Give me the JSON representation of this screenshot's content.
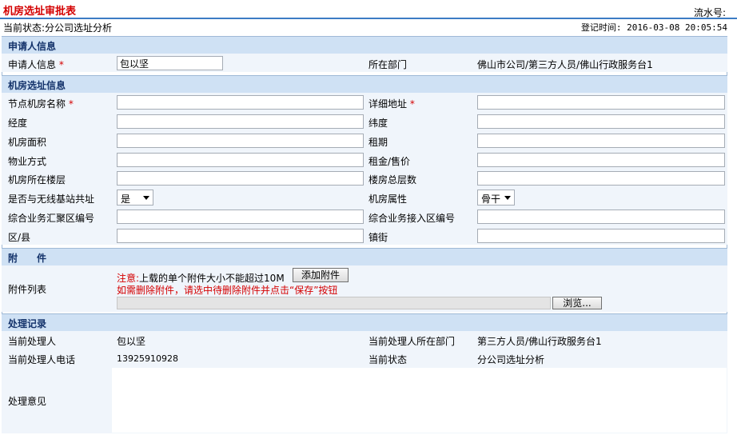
{
  "form": {
    "title": "机房选址审批表",
    "serial_label": "流水号:",
    "current_status_label": "当前状态:",
    "current_status_value": "分公司选址分析",
    "register_time_label": "登记时间:",
    "register_time_value": "2016-03-08 20:05:54"
  },
  "applicant": {
    "section_title": "申请人信息",
    "applicant_label": "申请人信息",
    "required_mark": "*",
    "applicant_value": "包以坚",
    "dept_label": "所在部门",
    "dept_value": "佛山市公司/第三方人员/佛山行政服务台1"
  },
  "site": {
    "section_title": "机房选址信息",
    "node_name_label": "节点机房名称",
    "address_label": "详细地址",
    "longitude_label": "经度",
    "latitude_label": "纬度",
    "area_label": "机房面积",
    "lease_term_label": "租期",
    "property_mode_label": "物业方式",
    "rent_label": "租金/售价",
    "floor_label": "机房所在楼层",
    "total_floors_label": "楼房总层数",
    "shared_label": "是否与无线基站共址",
    "shared_value": "是",
    "attr_label": "机房属性",
    "attr_value": "骨干",
    "agg_area_label": "综合业务汇聚区编号",
    "access_area_label": "综合业务接入区编号",
    "district_label": "区/县",
    "town_label": "镇街"
  },
  "attach": {
    "section_title": "附　　件",
    "list_label": "附件列表",
    "note_prefix": "注意:",
    "note_text": "上载的单个附件大小不能超过10M",
    "add_button": "添加附件",
    "delete_hint": "如需删除附件，请选中待删除附件并点击“保存”按钮",
    "browse_button": "浏览..."
  },
  "process": {
    "section_title": "处理记录",
    "handler_label": "当前处理人",
    "handler_value": "包以坚",
    "handler_dept_label": "当前处理人所在部门",
    "handler_dept_value": "第三方人员/佛山行政服务台1",
    "phone_label": "当前处理人电话",
    "phone_value": "13925910928",
    "state_label": "当前状态",
    "state_value": "分公司选址分析",
    "opinion_label": "处理意见"
  }
}
